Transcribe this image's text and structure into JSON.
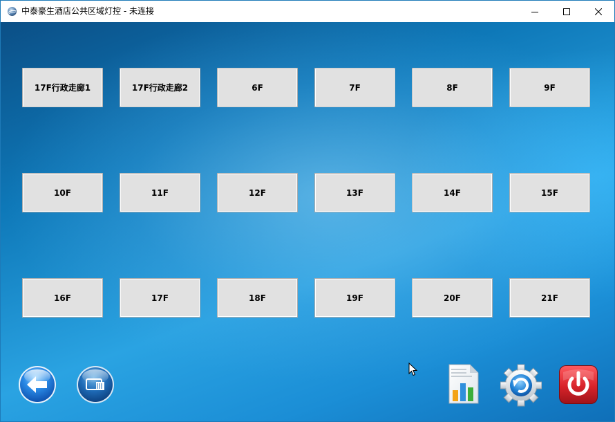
{
  "window": {
    "title": "中泰豪生酒店公共区域灯控 - 未连接",
    "controls": [
      "minimize",
      "maximize",
      "close"
    ]
  },
  "floors": [
    {
      "label": "17F行政走廊1"
    },
    {
      "label": "17F行政走廊2"
    },
    {
      "label": "6F"
    },
    {
      "label": "7F"
    },
    {
      "label": "8F"
    },
    {
      "label": "9F"
    },
    {
      "label": "10F"
    },
    {
      "label": "11F"
    },
    {
      "label": "12F"
    },
    {
      "label": "13F"
    },
    {
      "label": "14F"
    },
    {
      "label": "15F"
    },
    {
      "label": "16F"
    },
    {
      "label": "17F"
    },
    {
      "label": "18F"
    },
    {
      "label": "19F"
    },
    {
      "label": "20F"
    },
    {
      "label": "21F"
    }
  ],
  "bottom_toolbar": {
    "left": [
      "back-arrow-icon",
      "connection-icon"
    ],
    "right": [
      "report-chart-icon",
      "settings-gear-icon",
      "power-icon"
    ]
  },
  "colors": {
    "button_face": "#e1e1e1",
    "power_red": "#d8232a",
    "back_blue": "#1a78d6"
  }
}
